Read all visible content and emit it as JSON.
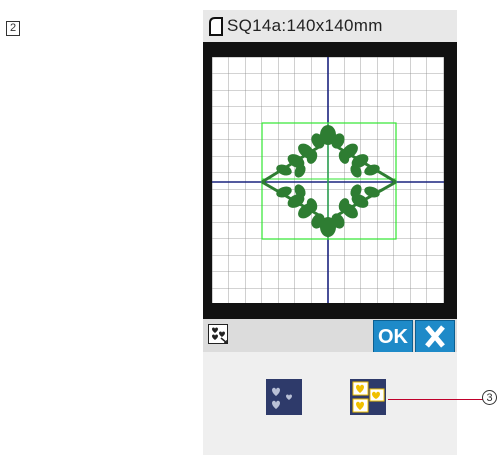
{
  "step_label": "2",
  "title": {
    "text": "SQ14a:140x140mm",
    "icon": "hoop-icon"
  },
  "toolbar": {
    "icon": "design-select-icon",
    "ok_label": "OK",
    "cancel_icon": "close-icon"
  },
  "pattern_buttons": [
    {
      "name": "single-hearts-icon",
      "state": "unselected"
    },
    {
      "name": "multi-hearts-icon",
      "state": "selected"
    }
  ],
  "callout": {
    "label": "3"
  },
  "colors": {
    "embroidery": "#2e7d32",
    "axis": "#1a237e",
    "grid": "#8a8a8a",
    "selection_box": "#31e631",
    "button_blue": "#1e8ac8",
    "pattern_bg": "#2e3a6a",
    "callout_line": "#c0002b"
  }
}
